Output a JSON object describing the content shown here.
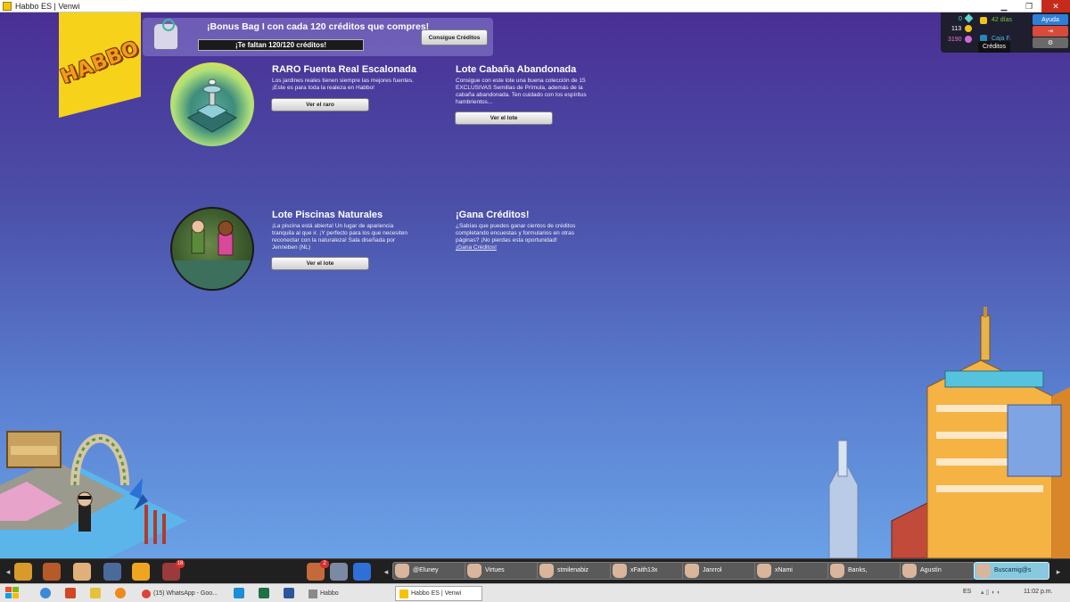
{
  "window": {
    "title": "Habbo ES | Venwi",
    "minimize": "▁",
    "restore": "❐",
    "close": "✕"
  },
  "logo": {
    "text": "HABBO"
  },
  "bonus": {
    "title": "¡Bonus Bag I con cada 120 créditos que compres!",
    "progress_text": "¡Te faltan 120/120 créditos!",
    "progress": 0,
    "button": "Consigue Créditos"
  },
  "promos": [
    {
      "title": "RARO Fuenta Real Escalonada",
      "desc": "Los jardines reales tienen siempre las mejores fuentes. ¡Este es para toda la realeza en Habbo!",
      "button": "Ver el raro"
    },
    {
      "title": "Lote Cabaña Abandonada",
      "desc": "Consigue con este lote una buena colección de 15 EXCLUSIVAS Semillas de Prímula, además de la cabaña abandonada. Ten cuidado con los espíritus hambrientos...",
      "button": "Ver el lote"
    },
    {
      "title": "Lote Piscinas Naturales",
      "desc": "¡La piscina está abierta! Un lugar de apariencia tranquila al que ir. ¡Y perfecto para los que necesiten reconectar con la naturaleza! Sala diseñada por Jenneben (NL)",
      "button": "Ver el lote"
    },
    {
      "title": "¡Gana Créditos!",
      "desc": "¿Sabías que puedes ganar cientos de créditos completando encuestas y formularios en otras páginas? ¡No pierdas esta oportunidad!",
      "link": "¡Gana Créditos!"
    }
  ],
  "hud": {
    "diamonds": "0",
    "credits": "113",
    "duckets": "3190",
    "club_days": "42 días",
    "caja": "Caja F.",
    "help": "Ayuda",
    "tooltip": "Créditos",
    "logout_icon": "exit-icon",
    "settings_icon": "gear-icon"
  },
  "toolbar": {
    "notification_count": "18",
    "friends_request_count": "2",
    "friends": [
      "@Eluney",
      "Virtues",
      "stmilenabiz",
      "xFaith13x",
      "Janrrol",
      "xNami",
      "Banks,",
      "Agustín",
      "Buscamig@s"
    ]
  },
  "taskbar": {
    "items": [
      "(15) WhatsApp - Goo...",
      "Habbo",
      "Habbo ES | Venwi"
    ],
    "lang": "ES",
    "time": "11:02 p.m."
  },
  "colors": {
    "accent_yellow": "#f6d21a",
    "sky_top": "#4a2f94",
    "sky_bottom": "#6aa1e6",
    "club_green": "#7cc63c",
    "help_blue": "#2f7fd8",
    "logout_red": "#d84a3a"
  }
}
